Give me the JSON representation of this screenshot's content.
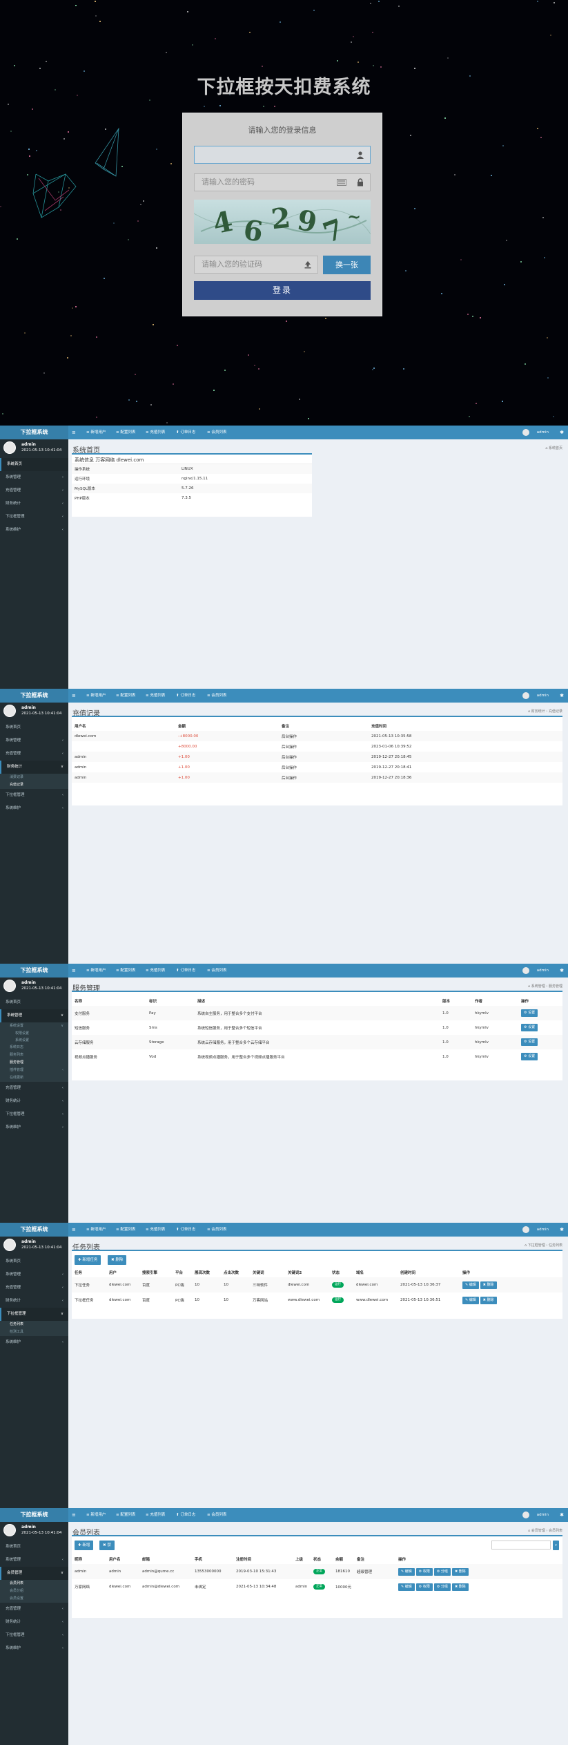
{
  "login": {
    "title": "下拉框按天扣费系统",
    "hint": "请输入您的登录信息",
    "username_placeholder": "",
    "password_placeholder": "请输入您的密码",
    "captcha_placeholder": "请输入您的验证码",
    "captcha_chars": [
      "4",
      "6",
      "2",
      "9",
      "7",
      "~"
    ],
    "swap_label": "换一张",
    "login_label": "登录"
  },
  "common": {
    "brand": "下拉框系统",
    "user_name": "admin",
    "user_time": "2021-05-13 10:41:04",
    "top_user": "admin",
    "nav": [
      "≡ 新增用户",
      "≡ 配置列表",
      "≡ 充值列表",
      "⬆ 订单日志",
      "≡ 会员列表"
    ]
  },
  "panel1": {
    "page_title": "系统首页",
    "crumb": "⌂ 系统首页",
    "sidebar": [
      {
        "label": "系统首页",
        "arrow": "",
        "type": "act"
      },
      {
        "label": "系统管理",
        "arrow": "‹",
        "type": ""
      },
      {
        "label": "充值管理",
        "arrow": "‹",
        "type": ""
      },
      {
        "label": "财务统计",
        "arrow": "‹",
        "type": ""
      },
      {
        "label": "下拉框管理",
        "arrow": "‹",
        "type": ""
      },
      {
        "label": "系统维护",
        "arrow": "‹",
        "type": ""
      }
    ],
    "box_header": "系统信息 万客网络 dlewei.com",
    "rows": [
      [
        "操作系统",
        "LINUX"
      ],
      [
        "运行环境",
        "nginx/1.15.11"
      ],
      [
        "MySQL版本",
        "5.7.26"
      ],
      [
        "PHP版本",
        "7.3.5"
      ]
    ]
  },
  "panel2": {
    "page_title": "充值记录",
    "crumb": "⌂ 财务统计 › 充值记录",
    "sidebar": [
      {
        "label": "系统首页",
        "arrow": "",
        "type": ""
      },
      {
        "label": "系统管理",
        "arrow": "‹",
        "type": ""
      },
      {
        "label": "充值管理",
        "arrow": "‹",
        "type": ""
      },
      {
        "label": "财务统计",
        "arrow": "∨",
        "type": "act"
      },
      {
        "label": "消费记录",
        "arrow": "",
        "type": "sub"
      },
      {
        "label": "充值记录",
        "arrow": "",
        "type": "sub on"
      },
      {
        "label": "下拉框管理",
        "arrow": "‹",
        "type": ""
      },
      {
        "label": "系统维护",
        "arrow": "‹",
        "type": ""
      }
    ],
    "columns": [
      "用户名",
      "金额",
      "备注",
      "充值时间"
    ],
    "rows": [
      [
        "dlewei.com",
        "-+8000.00",
        "后台操作",
        "2021-05-13 10:35:58"
      ],
      [
        "",
        "+8000.00",
        "后台操作",
        "2023-01-06 10:39:52"
      ],
      [
        "admin",
        "+1.00",
        "后台操作",
        "2019-12-27 20:18:45"
      ],
      [
        "admin",
        "+1.00",
        "后台操作",
        "2019-12-27 20:18:41"
      ],
      [
        "admin",
        "+1.00",
        "后台操作",
        "2019-12-27 20:18:36"
      ]
    ]
  },
  "panel3": {
    "page_title": "服务管理",
    "crumb": "⌂ 系统管理 › 服务管理",
    "sidebar": [
      {
        "label": "系统首页",
        "arrow": "",
        "type": ""
      },
      {
        "label": "系统管理",
        "arrow": "∨",
        "type": "act"
      },
      {
        "label": "系统设置",
        "arrow": "∨",
        "type": "sub"
      },
      {
        "label": "权限设置",
        "arrow": "",
        "type": "subsub"
      },
      {
        "label": "系统设置",
        "arrow": "",
        "type": "subsub"
      },
      {
        "label": "系统日志",
        "arrow": "",
        "type": "sub"
      },
      {
        "label": "服务列表",
        "arrow": "",
        "type": "sub"
      },
      {
        "label": "服务管理",
        "arrow": "",
        "type": "sub on"
      },
      {
        "label": "插件管理",
        "arrow": "‹",
        "type": "sub"
      },
      {
        "label": "在线更新",
        "arrow": "",
        "type": "sub"
      },
      {
        "label": "充值管理",
        "arrow": "‹",
        "type": ""
      },
      {
        "label": "财务统计",
        "arrow": "‹",
        "type": ""
      },
      {
        "label": "下拉框管理",
        "arrow": "‹",
        "type": ""
      },
      {
        "label": "系统维护",
        "arrow": "‹",
        "type": ""
      }
    ],
    "columns": [
      "名称",
      "标识",
      "描述",
      "版本",
      "作者",
      "操作"
    ],
    "rows": [
      [
        "支付服务",
        "Pay",
        "系统自主服务，用于整合多个支付平台",
        "1.0",
        "hkymlv"
      ],
      [
        "短信服务",
        "Sms",
        "系统短信服务，用于整合多个短信平台",
        "1.0",
        "hkymlv"
      ],
      [
        "云存储服务",
        "Storage",
        "系统云存储服务，用于整合多个云存储平台",
        "1.0",
        "hkymlv"
      ],
      [
        "视频点播服务",
        "Vod",
        "系统视频点播服务，用于整合多个视频点播服务平台",
        "1.0",
        "hkymlv"
      ]
    ],
    "op_label": "⚙ 设置"
  },
  "panel4": {
    "page_title": "任务列表",
    "crumb": "⌂ 下拉框管理 › 任务列表",
    "sidebar": [
      {
        "label": "系统首页",
        "arrow": "",
        "type": ""
      },
      {
        "label": "系统管理",
        "arrow": "‹",
        "type": ""
      },
      {
        "label": "充值管理",
        "arrow": "‹",
        "type": ""
      },
      {
        "label": "财务统计",
        "arrow": "‹",
        "type": ""
      },
      {
        "label": "下拉框管理",
        "arrow": "∨",
        "type": "act"
      },
      {
        "label": "任务列表",
        "arrow": "",
        "type": "sub on"
      },
      {
        "label": "检测工具",
        "arrow": "",
        "type": "sub"
      },
      {
        "label": "系统维护",
        "arrow": "‹",
        "type": ""
      }
    ],
    "btn_add": "✚ 新增任务",
    "btn_del": "✖ 删除",
    "columns": [
      "任务",
      "用户",
      "搜索引擎",
      "平台",
      "展现次数",
      "点击次数",
      "关键词",
      "关键词2",
      "状态",
      "域名",
      "创建时间",
      "操作"
    ],
    "rows": [
      [
        "下拉任务",
        "dlewei.com",
        "百度",
        "PC端",
        "10",
        "10",
        "三味软件",
        "dlewei.com",
        "运行",
        "dlewei.com",
        "2021-05-13 10:36:37"
      ],
      [
        "下拉框任务",
        "dlewei.com",
        "百度",
        "PC端",
        "10",
        "10",
        "万客网站",
        "www.dlewei.com",
        "运行",
        "www.dlewei.com",
        "2021-05-13 10:36:51"
      ]
    ],
    "op_edit": "✎ 编辑",
    "op_del": "✖ 删除"
  },
  "panel5": {
    "page_title": "会员列表",
    "crumb": "⌂ 会员管理 › 会员列表",
    "sidebar": [
      {
        "label": "系统首页",
        "arrow": "",
        "type": ""
      },
      {
        "label": "系统管理",
        "arrow": "‹",
        "type": ""
      },
      {
        "label": "会员管理",
        "arrow": "∨",
        "type": "act"
      },
      {
        "label": "会员列表",
        "arrow": "",
        "type": "sub on"
      },
      {
        "label": "会员分组",
        "arrow": "",
        "type": "sub"
      },
      {
        "label": "会员设置",
        "arrow": "",
        "type": "sub"
      },
      {
        "label": "充值管理",
        "arrow": "‹",
        "type": ""
      },
      {
        "label": "财务统计",
        "arrow": "‹",
        "type": ""
      },
      {
        "label": "下拉框管理",
        "arrow": "‹",
        "type": ""
      },
      {
        "label": "系统维护",
        "arrow": "‹",
        "type": ""
      }
    ],
    "btn_add": "✚ 新增",
    "btn_del": "✖ 禁",
    "search_placeholder": "",
    "columns": [
      "昵称",
      "用户名",
      "邮箱",
      "手机",
      "注册时间",
      "上级",
      "状态",
      "余额",
      "备注",
      "操作"
    ],
    "rows": [
      [
        "admin",
        "admin",
        "admin@qume.cc",
        "13553000000",
        "2019-03-10 15:31:43",
        "",
        "正常",
        "181610",
        "超级管理"
      ],
      [
        "万家网络",
        "dlewei.com",
        "admin@dlewei.com",
        "未绑定",
        "2021-05-13 10:34:48",
        "admin",
        "正常",
        "10000元",
        ""
      ]
    ],
    "ops": [
      "✎ 编辑",
      "⚙ 权限",
      "⚙ 分组",
      "✖ 删除"
    ]
  }
}
